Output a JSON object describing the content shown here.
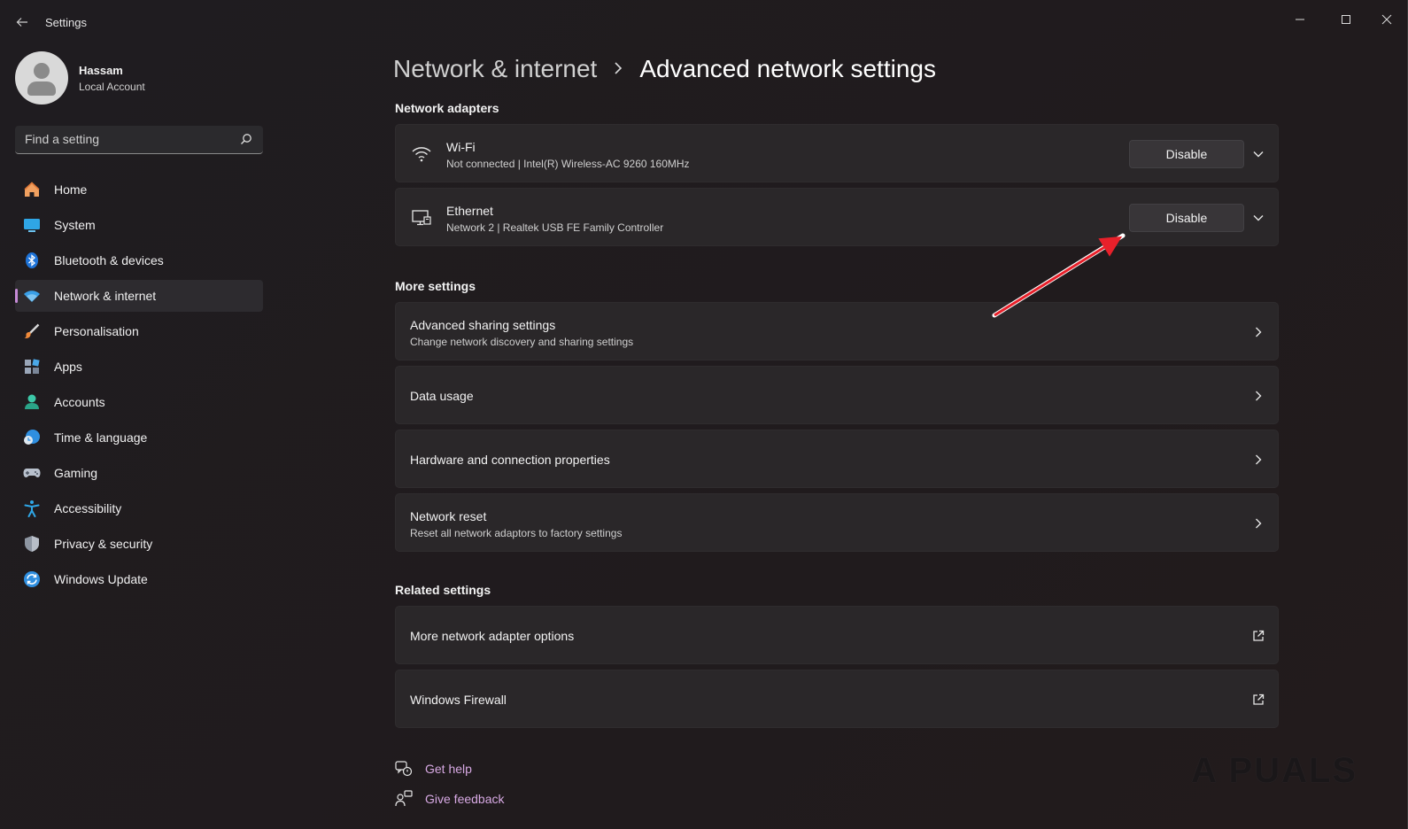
{
  "window": {
    "title": "Settings",
    "controls": [
      "minimize",
      "maximize",
      "close"
    ]
  },
  "profile": {
    "name": "Hassam",
    "account_type": "Local Account"
  },
  "search": {
    "placeholder": "Find a setting"
  },
  "sidebar": {
    "items": [
      {
        "label": "Home",
        "icon": "home-icon",
        "active": false
      },
      {
        "label": "System",
        "icon": "system-icon",
        "active": false
      },
      {
        "label": "Bluetooth & devices",
        "icon": "bluetooth-icon",
        "active": false
      },
      {
        "label": "Network & internet",
        "icon": "network-icon",
        "active": true
      },
      {
        "label": "Personalisation",
        "icon": "brush-icon",
        "active": false
      },
      {
        "label": "Apps",
        "icon": "apps-icon",
        "active": false
      },
      {
        "label": "Accounts",
        "icon": "accounts-icon",
        "active": false
      },
      {
        "label": "Time & language",
        "icon": "time-language-icon",
        "active": false
      },
      {
        "label": "Gaming",
        "icon": "gaming-icon",
        "active": false
      },
      {
        "label": "Accessibility",
        "icon": "accessibility-icon",
        "active": false
      },
      {
        "label": "Privacy & security",
        "icon": "shield-icon",
        "active": false
      },
      {
        "label": "Windows Update",
        "icon": "update-icon",
        "active": false
      }
    ]
  },
  "breadcrumb": {
    "parent": "Network & internet",
    "separator": ">",
    "current": "Advanced network settings"
  },
  "sections": {
    "adapters": {
      "label": "Network adapters",
      "items": [
        {
          "title": "Wi-Fi",
          "subtitle": "Not connected | Intel(R) Wireless-AC 9260 160MHz",
          "button": "Disable",
          "icon": "wifi-icon"
        },
        {
          "title": "Ethernet",
          "subtitle": "Network 2 | Realtek USB FE Family Controller",
          "button": "Disable",
          "icon": "ethernet-icon"
        }
      ]
    },
    "more": {
      "label": "More settings",
      "items": [
        {
          "title": "Advanced sharing settings",
          "subtitle": "Change network discovery and sharing settings"
        },
        {
          "title": "Data usage",
          "subtitle": ""
        },
        {
          "title": "Hardware and connection properties",
          "subtitle": ""
        },
        {
          "title": "Network reset",
          "subtitle": "Reset all network adaptors to factory settings"
        }
      ]
    },
    "related": {
      "label": "Related settings",
      "items": [
        {
          "title": "More network adapter options",
          "icon": "external-link-icon"
        },
        {
          "title": "Windows Firewall",
          "icon": "external-link-icon"
        }
      ]
    }
  },
  "help": {
    "get_help": "Get help",
    "give_feedback": "Give feedback"
  },
  "watermark": "A PUALS",
  "colors": {
    "accent": "#c58ad6",
    "link": "#d7a9e3",
    "annotation_arrow": "#e8202a"
  }
}
